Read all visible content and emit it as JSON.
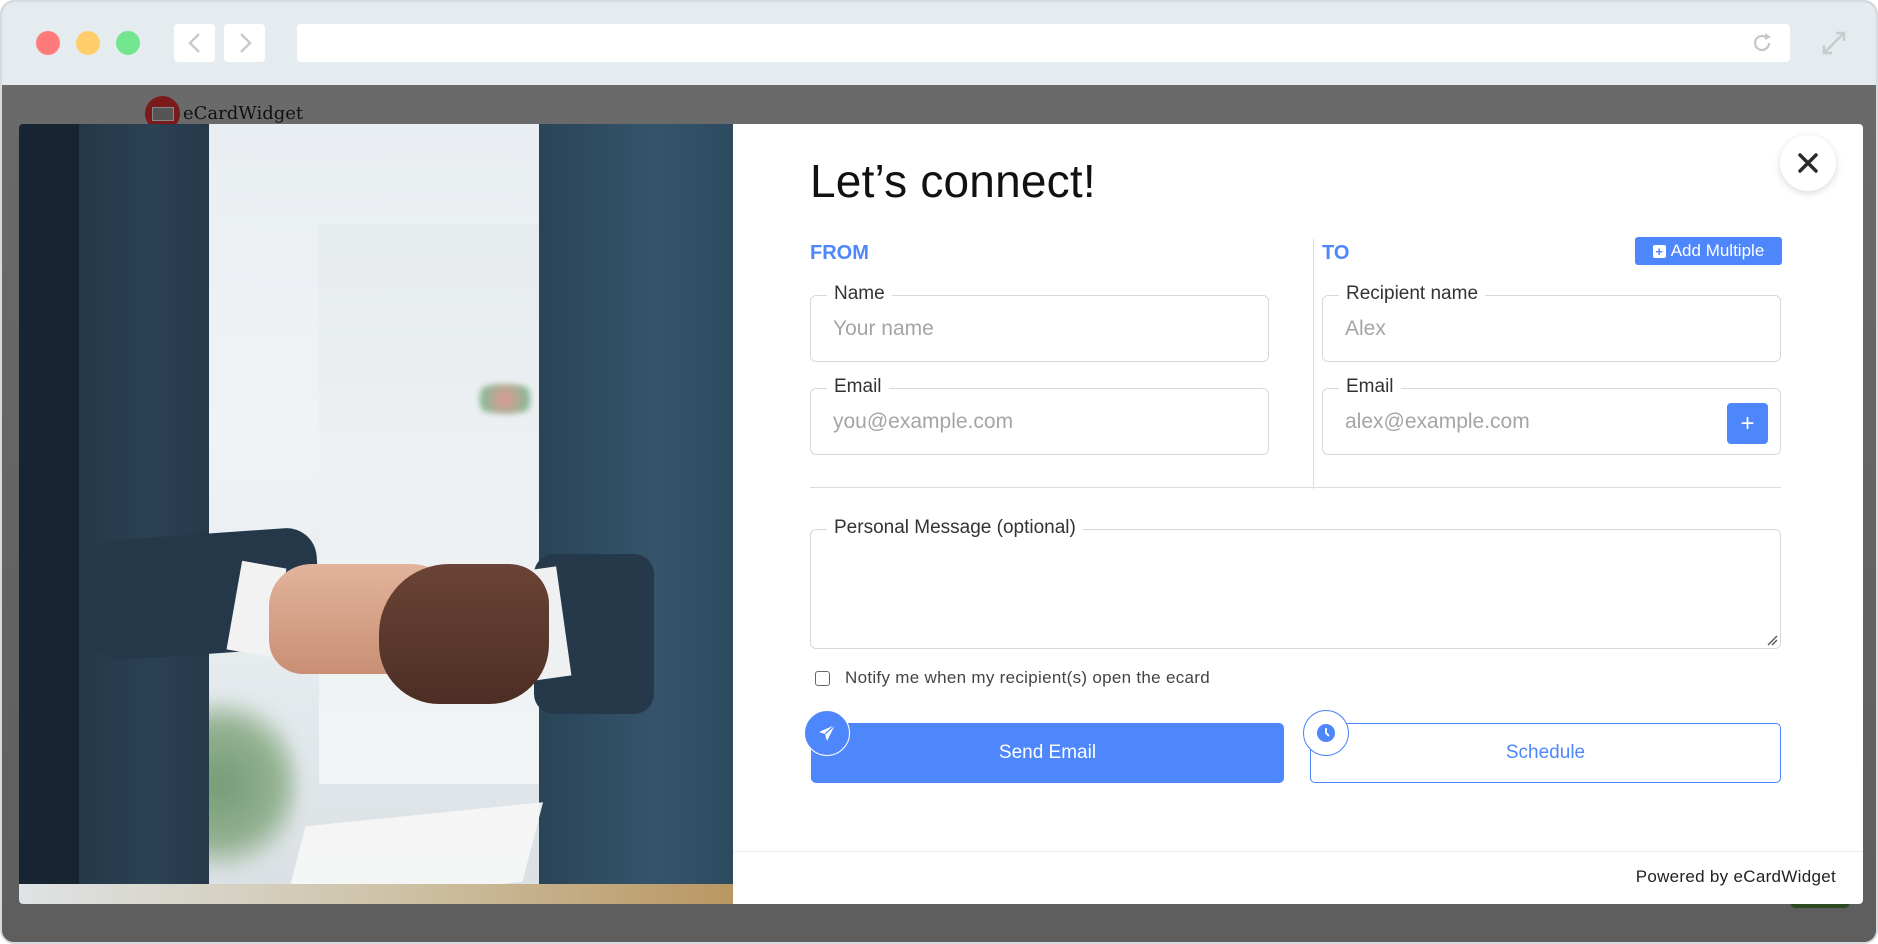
{
  "browser": {
    "url": "",
    "icons": {
      "back": "chevron-left-icon",
      "forward": "chevron-right-icon",
      "reload": "reload-icon",
      "expand": "expand-icon"
    }
  },
  "site": {
    "logo_text": "eCardWidget"
  },
  "modal": {
    "title": "Let’s connect!",
    "from": {
      "heading": "FROM",
      "name_label": "Name",
      "name_placeholder": "Your name",
      "name_value": "",
      "email_label": "Email",
      "email_placeholder": "you@example.com",
      "email_value": ""
    },
    "to": {
      "heading": "TO",
      "add_multiple_label": "Add Multiple",
      "name_label": "Recipient name",
      "name_placeholder": "Alex",
      "name_value": "",
      "email_label": "Email",
      "email_placeholder": "alex@example.com",
      "email_value": "",
      "add_email_symbol": "+"
    },
    "message": {
      "label": "Personal Message (optional)",
      "value": ""
    },
    "notify": {
      "label": "Notify me when my recipient(s) open the ecard",
      "checked": false
    },
    "buttons": {
      "send": "Send Email",
      "schedule": "Schedule"
    },
    "footer": "Powered by eCardWidget",
    "close_symbol": "✕"
  },
  "colors": {
    "accent": "#4e86fb",
    "chrome": "#e5ecf0",
    "overlay": "#666666"
  }
}
